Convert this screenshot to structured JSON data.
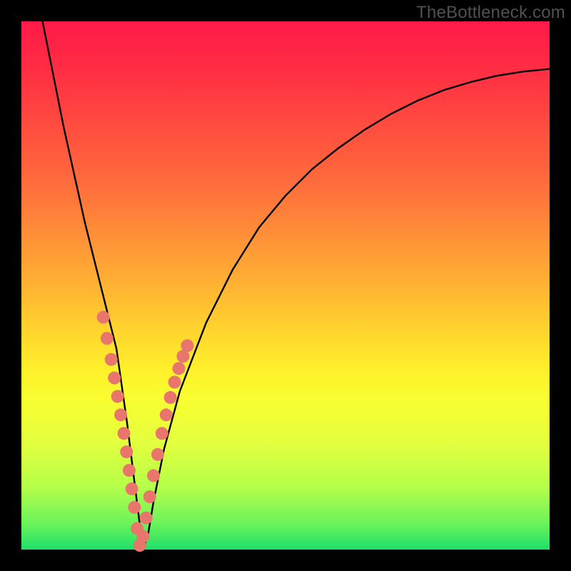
{
  "watermark": "TheBottleneck.com",
  "chart_data": {
    "type": "line",
    "title": "",
    "xlabel": "",
    "ylabel": "",
    "xlim": [
      0,
      100
    ],
    "ylim": [
      0,
      100
    ],
    "grid": false,
    "legend": false,
    "series": [
      {
        "name": "bottleneck-curve",
        "x": [
          4,
          6,
          8,
          10,
          12,
          14,
          16,
          18,
          19,
          20,
          21,
          22,
          23,
          24,
          25,
          27,
          30,
          35,
          40,
          45,
          50,
          55,
          60,
          65,
          70,
          75,
          80,
          85,
          90,
          95,
          100
        ],
        "y": [
          100,
          90,
          80,
          71,
          62,
          54,
          46,
          38,
          31,
          24,
          16,
          8,
          0,
          3,
          9,
          19,
          30,
          43,
          53,
          61,
          67,
          72,
          76,
          79.5,
          82.5,
          85,
          87,
          88.5,
          89.7,
          90.5,
          91
        ]
      }
    ],
    "markers": {
      "name": "highlight-dots",
      "color": "#e9766c",
      "radius": 9,
      "points_xy": [
        [
          15.5,
          44
        ],
        [
          16.2,
          40
        ],
        [
          17.0,
          36
        ],
        [
          17.6,
          32.5
        ],
        [
          18.2,
          29
        ],
        [
          18.8,
          25.5
        ],
        [
          19.4,
          22
        ],
        [
          19.9,
          18.5
        ],
        [
          20.4,
          15
        ],
        [
          20.9,
          11.5
        ],
        [
          21.4,
          8
        ],
        [
          21.9,
          4
        ],
        [
          22.4,
          0.8
        ],
        [
          23.0,
          2.5
        ],
        [
          23.6,
          6
        ],
        [
          24.3,
          10
        ],
        [
          25.0,
          14
        ],
        [
          25.8,
          18
        ],
        [
          26.6,
          22
        ],
        [
          27.4,
          25.5
        ],
        [
          28.2,
          28.8
        ],
        [
          29.0,
          31.7
        ],
        [
          29.8,
          34.3
        ],
        [
          30.6,
          36.6
        ],
        [
          31.4,
          38.6
        ]
      ]
    }
  }
}
